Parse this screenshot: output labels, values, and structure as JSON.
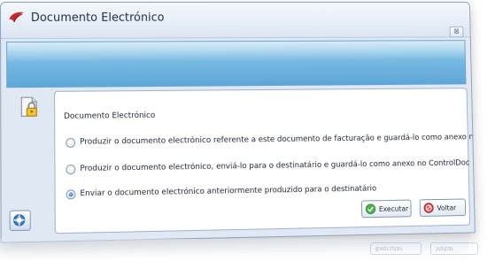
{
  "window": {
    "title": "Documento Electrónico",
    "close_glyph": "⊠",
    "icons": [
      "app-logo-icon",
      "lock-document-icon",
      "help-icon",
      "close-icon"
    ]
  },
  "group": {
    "title": "Documento Electrónico",
    "options": [
      {
        "label": "Produzir o documento electrónico referente a este documento de facturação e guardá-lo como anexo no ControlDoc",
        "checked": false
      },
      {
        "label": "Produzir o documento electrónico, enviá-lo para o destinatário e guardá-lo como anexo no ControlDoc",
        "checked": false
      },
      {
        "label": "Enviar o documento electrónico anteriormente produzido para o destinatário",
        "checked": true
      }
    ]
  },
  "buttons": {
    "execute": {
      "label": "Executar",
      "icon": "check-icon"
    },
    "back": {
      "label": "Voltar",
      "icon": "no-entry-icon"
    }
  },
  "colors": {
    "banner": "#77b9e2",
    "window_bg": "#dfe8f3",
    "border": "#8da2bf"
  }
}
